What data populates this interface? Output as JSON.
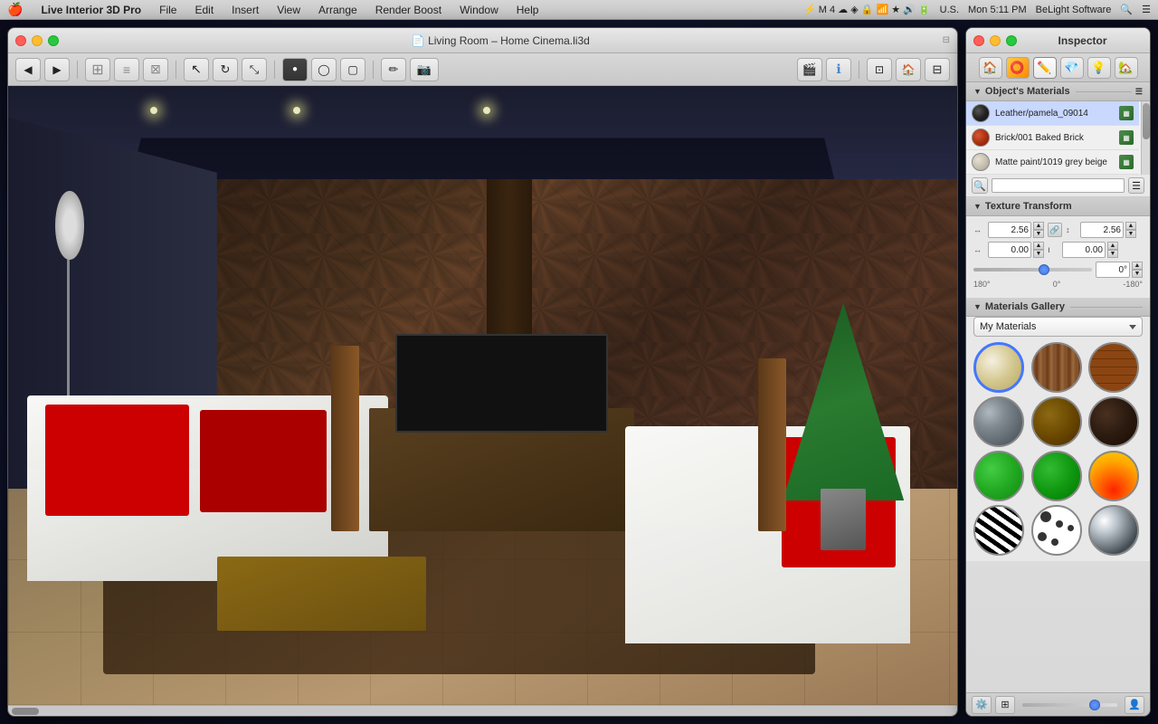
{
  "menubar": {
    "apple": "🍎",
    "items": [
      "Live Interior 3D Pro",
      "File",
      "Edit",
      "Insert",
      "View",
      "Arrange",
      "Render Boost",
      "Window",
      "Help"
    ],
    "right": {
      "time": "Mon 5:11 PM",
      "company": "BeLight Software"
    }
  },
  "window": {
    "title": "Living Room – Home Cinema.li3d",
    "title_icon": "📄"
  },
  "inspector": {
    "title": "Inspector",
    "tabs": [
      {
        "label": "🏠",
        "id": "object"
      },
      {
        "label": "⭕",
        "id": "material",
        "active": true
      },
      {
        "label": "✏️",
        "id": "edit"
      },
      {
        "label": "💎",
        "id": "texture"
      },
      {
        "label": "💡",
        "id": "light"
      },
      {
        "label": "🏡",
        "id": "scene"
      }
    ],
    "sections": {
      "materials": {
        "title": "Object's Materials",
        "items": [
          {
            "name": "Leather/pamela_09014",
            "swatch": "#3a3a3a",
            "type": "dark"
          },
          {
            "name": "Brick/001 Baked Brick",
            "swatch": "#cc4422",
            "type": "brick"
          },
          {
            "name": "Matte paint/1019 grey beige",
            "swatch": "#d0c8b8",
            "type": "light"
          }
        ]
      },
      "texture_transform": {
        "title": "Texture Transform",
        "scale_x": "2.56",
        "scale_y": "2.56",
        "offset_x": "0.00",
        "offset_y": "0.00",
        "rotation": "0°",
        "rotation_min": "180°",
        "rotation_mid": "0°",
        "rotation_max": "-180°"
      },
      "gallery": {
        "title": "Materials Gallery",
        "dropdown_value": "My Materials",
        "swatches": [
          {
            "id": "cream",
            "label": "Cream",
            "selected": true
          },
          {
            "id": "wood1",
            "label": "Wood 1"
          },
          {
            "id": "brick",
            "label": "Brick"
          },
          {
            "id": "metal",
            "label": "Metal"
          },
          {
            "id": "brown",
            "label": "Brown"
          },
          {
            "id": "darkbrown",
            "label": "Dark Brown"
          },
          {
            "id": "green1",
            "label": "Green 1"
          },
          {
            "id": "green2",
            "label": "Green 2"
          },
          {
            "id": "fire",
            "label": "Fire"
          },
          {
            "id": "zebra",
            "label": "Zebra"
          },
          {
            "id": "spots",
            "label": "Spots"
          },
          {
            "id": "chrome",
            "label": "Chrome"
          }
        ]
      }
    }
  },
  "toolbar": {
    "back": "◀",
    "fwd": "▶",
    "plan": "⊞",
    "elevation": "≡",
    "overview": "⊠",
    "select": "↖",
    "transform": "↻",
    "move": "⤡",
    "point": "●",
    "circle": "◯",
    "square": "▢",
    "draw": "✏",
    "camera": "📷",
    "render": "🎬",
    "info": "ℹ",
    "walls2d": "⊡",
    "home": "🏠",
    "window3d": "⊟"
  }
}
